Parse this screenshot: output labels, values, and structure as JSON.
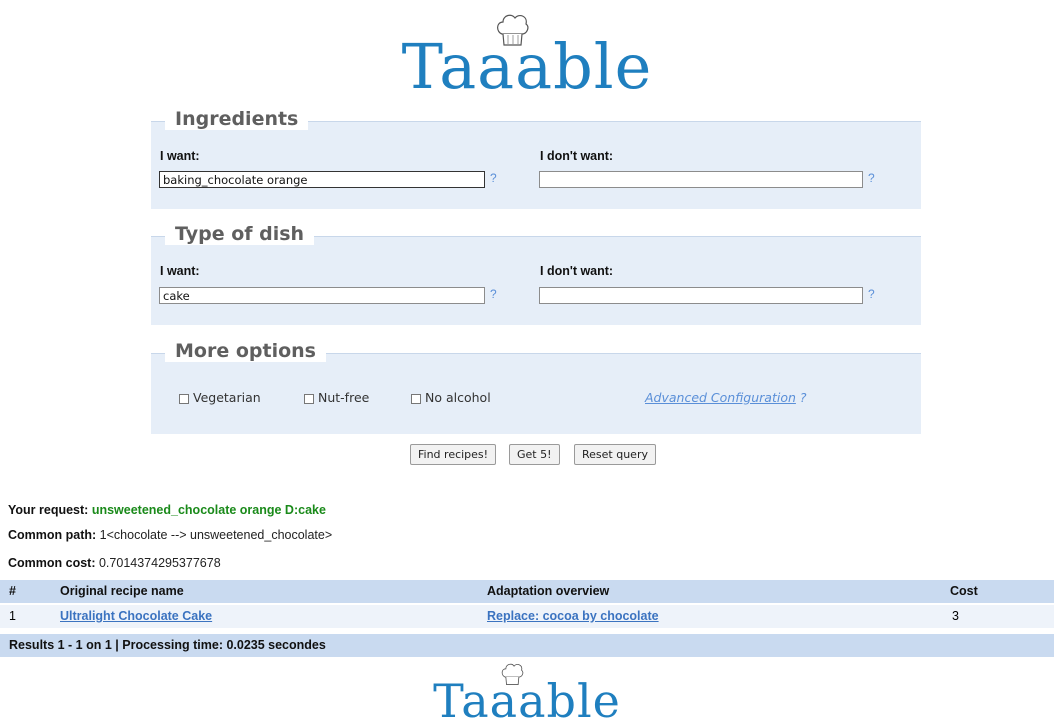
{
  "logo": {
    "text": "Taaable"
  },
  "ingredients": {
    "legend": "Ingredients",
    "want_label": "I want:",
    "want_value": "baking_chocolate orange",
    "dont_label": "I don't want:",
    "dont_value": "",
    "help": "?"
  },
  "dish": {
    "legend": "Type of dish",
    "want_label": "I want:",
    "want_value": "cake",
    "dont_label": "I don't want:",
    "dont_value": "",
    "help": "?"
  },
  "options": {
    "legend": "More options",
    "vegetarian": "Vegetarian",
    "nutfree": "Nut-free",
    "noalcohol": "No alcohol",
    "advanced": "Advanced Configuration",
    "help": "?"
  },
  "buttons": {
    "find": "Find recipes!",
    "get5": "Get 5!",
    "reset": "Reset query"
  },
  "result": {
    "request_label": "Your request:",
    "request_value": "unsweetened_chocolate orange D:cake",
    "path_label": "Common path:",
    "path_value": "1<chocolate --> unsweetened_chocolate>",
    "cost_label": "Common cost:",
    "cost_value": "0.7014374295377678"
  },
  "table": {
    "headers": [
      "#",
      "Original recipe name",
      "Adaptation overview",
      "Cost"
    ],
    "rows": [
      {
        "num": "1",
        "name": "Ultralight Chocolate Cake",
        "adaptation": "Replace: cocoa by chocolate",
        "cost": "3"
      }
    ],
    "footer": "Results 1 - 1 on 1 | Processing time: 0.0235 secondes"
  },
  "colors": {
    "accent": "#1f7fbf",
    "panel": "#e6eef8",
    "table_header": "#c9daf0",
    "request_green": "#1a8a1a",
    "link": "#3b73c0"
  }
}
